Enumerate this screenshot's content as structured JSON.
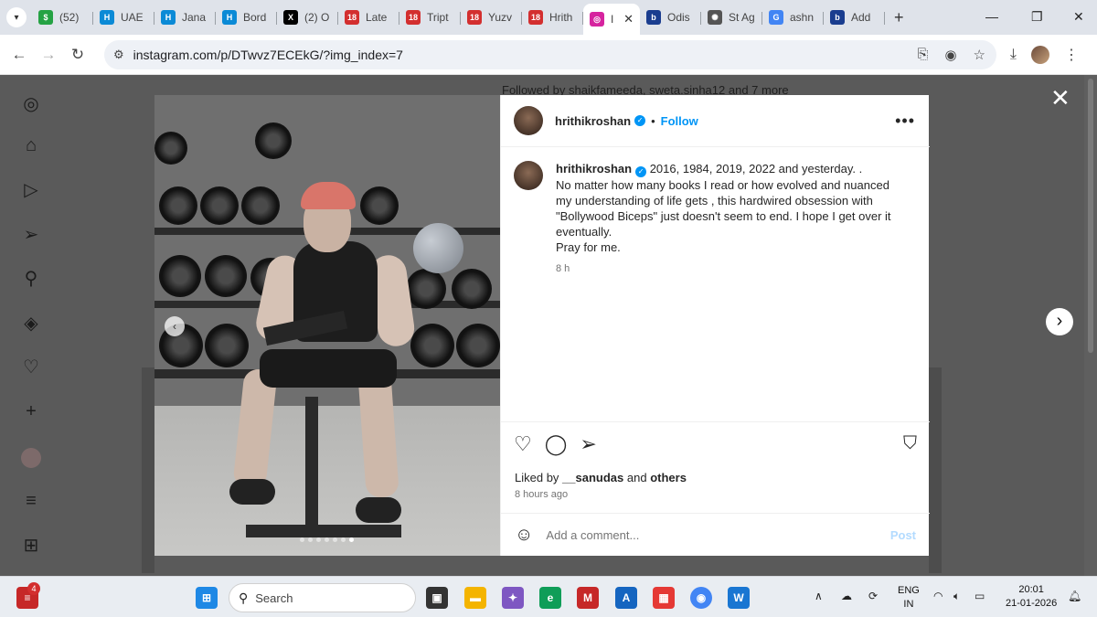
{
  "browser": {
    "tabs": [
      {
        "label": "(52)",
        "color": "#25a244",
        "glyph": "$"
      },
      {
        "label": "UAE",
        "color": "#0b8ad6",
        "glyph": "H"
      },
      {
        "label": "Jana",
        "color": "#0b8ad6",
        "glyph": "H"
      },
      {
        "label": "Bord",
        "color": "#0b8ad6",
        "glyph": "H"
      },
      {
        "label": "(2) O",
        "color": "#000000",
        "glyph": "X"
      },
      {
        "label": "Late",
        "color": "#d32f2f",
        "glyph": "18"
      },
      {
        "label": "Tript",
        "color": "#d32f2f",
        "glyph": "18"
      },
      {
        "label": "Yuzv",
        "color": "#d32f2f",
        "glyph": "18"
      },
      {
        "label": "Hrith",
        "color": "#d32f2f",
        "glyph": "18"
      },
      {
        "label": "I",
        "color": "#d6249f",
        "glyph": "◎",
        "active": true
      },
      {
        "label": "Odis",
        "color": "#1a3d8f",
        "glyph": "b"
      },
      {
        "label": "St Ag",
        "color": "#555555",
        "glyph": "✺"
      },
      {
        "label": "ashn",
        "color": "#4285f4",
        "glyph": "G"
      },
      {
        "label": "Add",
        "color": "#1a3d8f",
        "glyph": "b"
      }
    ],
    "url": "instagram.com/p/DTwvz7ECEkG/?img_index=7"
  },
  "background": {
    "followed_by_text": "Followed by shaikfameeda, sweta.sinha12 and 7 more"
  },
  "post": {
    "username": "hrithikroshan",
    "follow_label": "Follow",
    "separator": "•",
    "caption_lines": [
      "2016, 1984, 2019, 2022 and yesterday. .",
      "No matter how many books I read or how evolved and nuanced",
      "my understanding of life gets , this hardwired obsession with",
      "\"Bollywood Biceps\" just doesn't seem to end. I hope I get over it",
      "eventually.",
      "Pray for me."
    ],
    "caption_time": "8 h",
    "liked_prefix": "Liked by",
    "liked_user": "__sanudas",
    "liked_and": "and",
    "liked_others": "others",
    "posted_ago": "8 hours ago",
    "comment_placeholder": "Add a comment...",
    "post_label": "Post"
  },
  "taskbar": {
    "search_label": "Search",
    "lang_top": "ENG",
    "lang_bottom": "IN",
    "time": "20:01",
    "date": "21-01-2026",
    "notification_count": "4"
  }
}
